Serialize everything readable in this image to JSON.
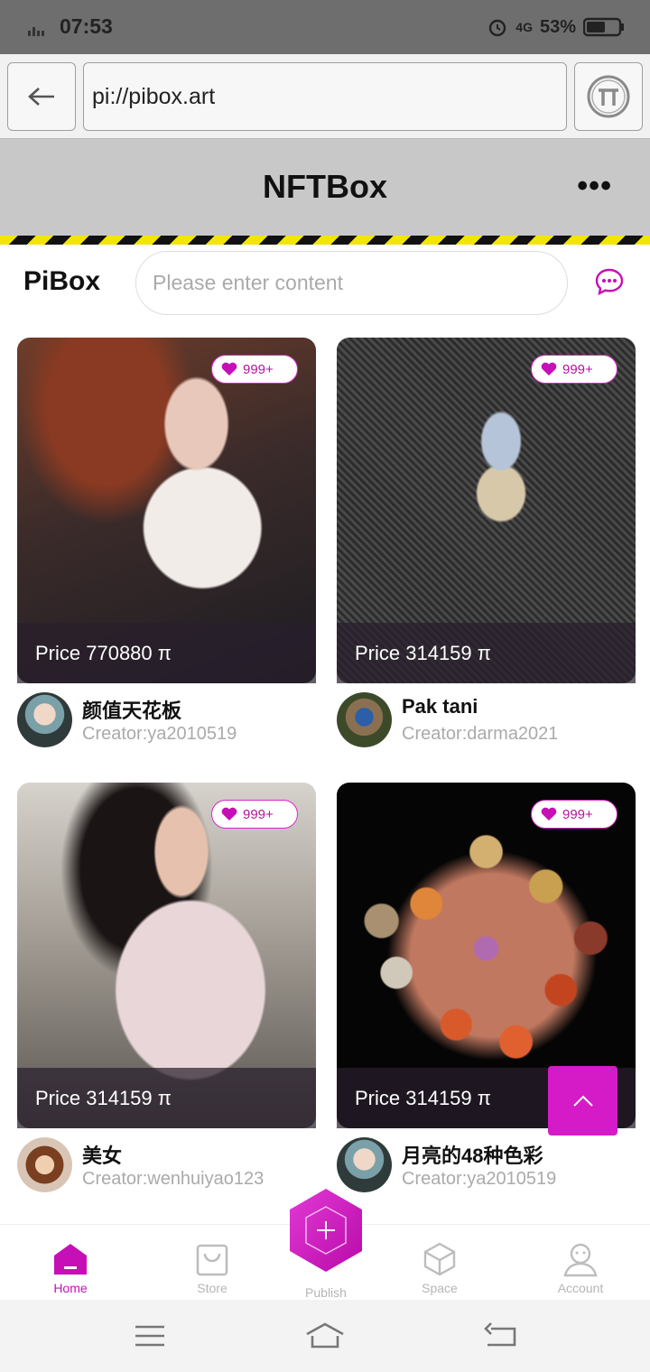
{
  "status": {
    "time": "07:53",
    "network": "4G",
    "battery": "53%",
    "signal_label": "4G"
  },
  "browser": {
    "url": "pi://pibox.art"
  },
  "header": {
    "title": "NFTBox",
    "more": "•••"
  },
  "search": {
    "brand": "PiBox",
    "placeholder": "Please enter content"
  },
  "cards": [
    {
      "likes": "999+",
      "price": "Price  770880 π",
      "name": "颜值天花板",
      "creator": "Creator:ya2010519"
    },
    {
      "likes": "999+",
      "price": "Price  314159 π",
      "name": "Pak tani",
      "creator": "Creator:darma2021"
    },
    {
      "likes": "999+",
      "price": "Price  314159 π",
      "name": "美女",
      "creator": "Creator:wenhuiyao123"
    },
    {
      "likes": "999+",
      "price": "Price  314159 π",
      "name": "月亮的48种色彩",
      "creator": "Creator:ya2010519"
    }
  ],
  "tabs": [
    {
      "label": "Home",
      "icon": "home-icon"
    },
    {
      "label": "Store",
      "icon": "bag-icon"
    },
    {
      "label": "Publish",
      "icon": "plus-hexagon-icon"
    },
    {
      "label": "Space",
      "icon": "cube-icon"
    },
    {
      "label": "Account",
      "icon": "user-icon"
    }
  ],
  "colors": {
    "accent": "#c60fb6",
    "hazard_yellow": "#f2e600",
    "header_bg": "#c8c8c8"
  }
}
